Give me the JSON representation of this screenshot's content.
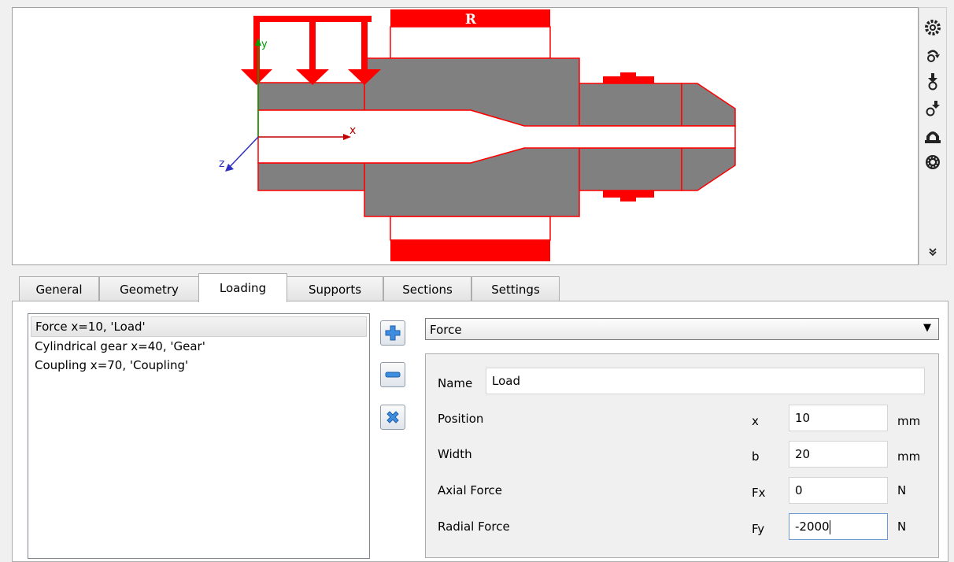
{
  "viewport": {
    "reaction_label": "R",
    "axes": {
      "x": "x",
      "y": "y",
      "z": "z"
    }
  },
  "toolbar": {
    "tools": [
      {
        "icon": "settings-gear-icon"
      },
      {
        "icon": "load-rotate-icon"
      },
      {
        "icon": "support-down-icon"
      },
      {
        "icon": "support-diagonal-icon"
      },
      {
        "icon": "bearing-icon"
      },
      {
        "icon": "gear-wheel-icon"
      },
      {
        "icon": "more-chevron-icon"
      }
    ]
  },
  "tabs": [
    {
      "label": "General",
      "active": false
    },
    {
      "label": "Geometry",
      "active": false
    },
    {
      "label": "Loading",
      "active": true
    },
    {
      "label": "Supports",
      "active": false
    },
    {
      "label": "Sections",
      "active": false
    },
    {
      "label": "Settings",
      "active": false
    }
  ],
  "loads_list": [
    {
      "label": "Force  x=10, 'Load'",
      "selected": true
    },
    {
      "label": "Cylindrical gear  x=40, 'Gear'",
      "selected": false
    },
    {
      "label": "Coupling  x=70, 'Coupling'",
      "selected": false
    }
  ],
  "buttons": {
    "add": "add-plus-icon",
    "remove": "remove-minus-icon",
    "delete": "delete-x-icon"
  },
  "load_type": {
    "selected": "Force"
  },
  "properties": {
    "name_label": "Name",
    "name_value": "Load",
    "rows": [
      {
        "label": "Position",
        "symbol": "x",
        "value": "10",
        "unit": "mm"
      },
      {
        "label": "Width",
        "symbol": "b",
        "value": "20",
        "unit": "mm"
      },
      {
        "label": "Axial Force",
        "symbol": "Fx",
        "value": "0",
        "unit": "N"
      },
      {
        "label": "Radial Force",
        "symbol": "Fy",
        "value": "-2000",
        "unit": "N"
      }
    ]
  },
  "colors": {
    "accent": "#ff0000",
    "shaft_fill": "#808080",
    "axis_x": "#c00000",
    "axis_y": "#00a000",
    "axis_z": "#3030c0"
  }
}
